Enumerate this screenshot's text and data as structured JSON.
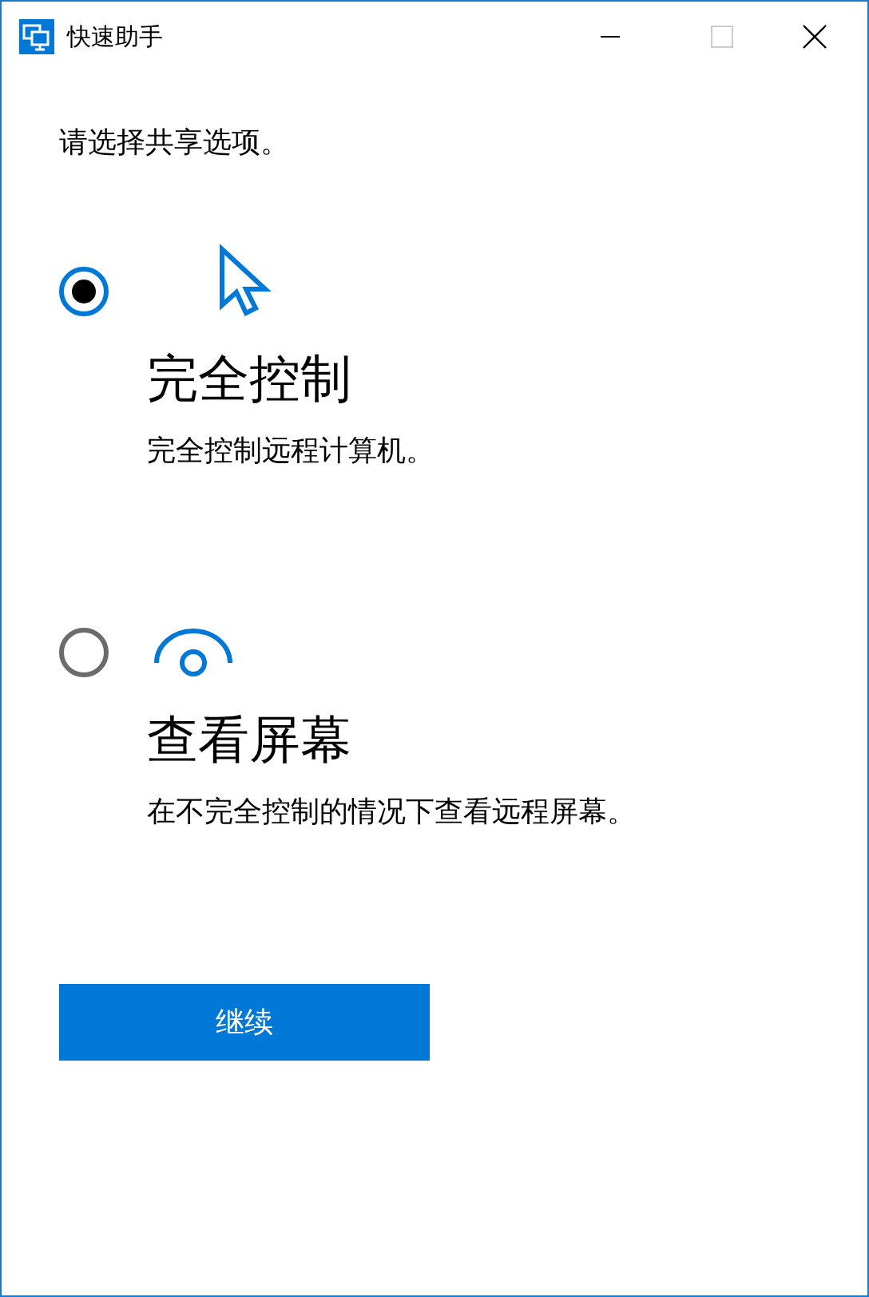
{
  "window": {
    "title": "快速助手",
    "maximize_disabled": true
  },
  "prompt": "请选择共享选项。",
  "options": [
    {
      "kind": "pointer",
      "title": "完全控制",
      "description": "完全控制远程计算机。",
      "selected": true
    },
    {
      "kind": "eye",
      "title": "查看屏幕",
      "description": "在不完全控制的情况下查看远程屏幕。",
      "selected": false
    }
  ],
  "continue_button": "继续"
}
